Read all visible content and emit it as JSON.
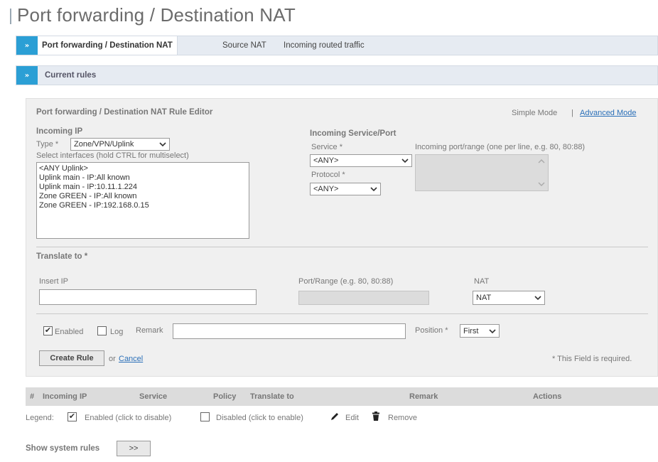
{
  "page_title": "Port forwarding / Destination NAT",
  "tabs": [
    {
      "label": "Port forwarding / Destination NAT",
      "active": true
    },
    {
      "label": "Source NAT",
      "active": false
    },
    {
      "label": "Incoming routed traffic",
      "active": false
    }
  ],
  "tab_icon": "»",
  "current_rules": {
    "icon": "»",
    "title": "Current rules"
  },
  "editor": {
    "title": "Port forwarding / Destination NAT Rule Editor",
    "simple_mode": "Simple Mode",
    "separator": "|",
    "advanced_mode": "Advanced Mode",
    "incoming_ip": {
      "heading": "Incoming IP",
      "type_label": "Type *",
      "type_value": "Zone/VPN/Uplink",
      "hint": "Select interfaces (hold CTRL for multiselect)",
      "interfaces": [
        "<ANY Uplink>",
        "Uplink main - IP:All known",
        "Uplink main - IP:10.11.1.224",
        "Zone GREEN - IP:All known",
        "Zone GREEN - IP:192.168.0.15"
      ]
    },
    "incoming_service": {
      "heading": "Incoming Service/Port",
      "service_label": "Service *",
      "service_value": "<ANY>",
      "protocol_label": "Protocol *",
      "protocol_value": "<ANY>",
      "port_label": "Incoming port/range (one per line, e.g. 80, 80:88)"
    },
    "translate": {
      "heading": "Translate to *",
      "insert_ip_label": "Insert IP",
      "insert_ip_value": "",
      "port_range_label": "Port/Range (e.g. 80, 80:88)",
      "nat_label": "NAT",
      "nat_value": "NAT"
    },
    "options": {
      "enabled_label": "Enabled",
      "enabled_checked": true,
      "log_label": "Log",
      "log_checked": false,
      "remark_label": "Remark",
      "remark_value": "",
      "position_label": "Position *",
      "position_value": "First"
    },
    "create_button": "Create Rule",
    "or_text": "or",
    "cancel_link": "Cancel",
    "required_note": "* This Field is required."
  },
  "table": {
    "columns": [
      "#",
      "Incoming IP",
      "Service",
      "Policy",
      "Translate to",
      "Remark",
      "Actions"
    ]
  },
  "legend": {
    "label": "Legend:",
    "enabled": "Enabled (click to disable)",
    "disabled": "Disabled (click to enable)",
    "edit": "Edit",
    "remove": "Remove"
  },
  "system_rules": {
    "label": "Show system rules",
    "button": ">>"
  },
  "colors": {
    "accent": "#2b9fd5",
    "link": "#2a6fb8",
    "bar_bg": "#e6ebf2",
    "panel_bg": "#f0f0f0"
  }
}
